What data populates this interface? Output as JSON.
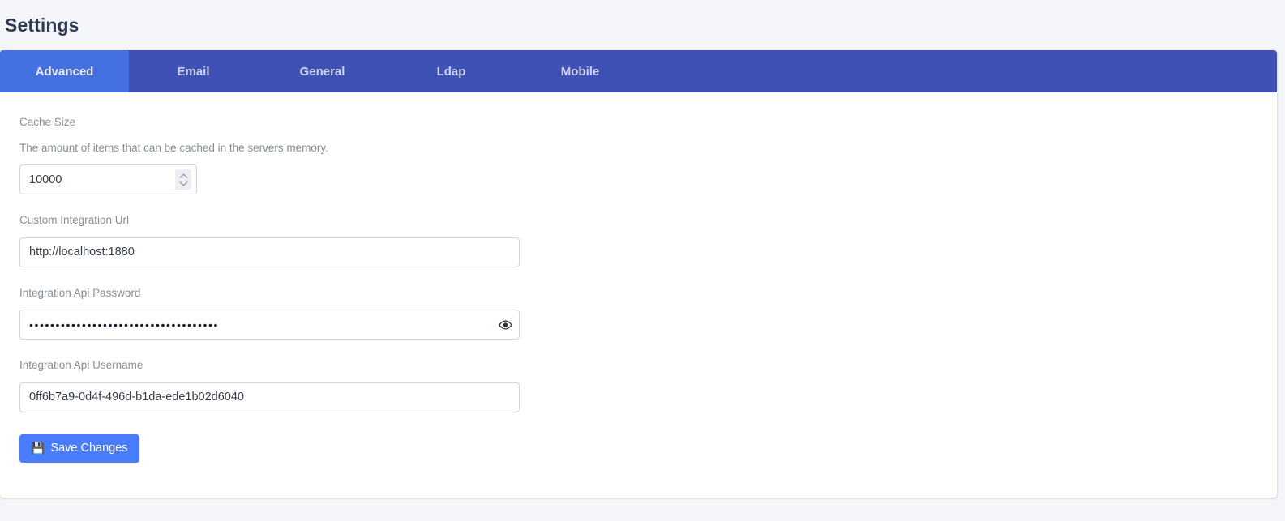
{
  "header": {
    "title": "Settings"
  },
  "tabs": {
    "active_index": 0,
    "items": [
      {
        "label": "Advanced"
      },
      {
        "label": "Email"
      },
      {
        "label": "General"
      },
      {
        "label": "Ldap"
      },
      {
        "label": "Mobile"
      }
    ]
  },
  "form": {
    "cache_size": {
      "label": "Cache Size",
      "help": "The amount of items that can be cached in the servers memory.",
      "value": "10000",
      "placeholder": "Cache Size"
    },
    "custom_integration_url": {
      "label": "Custom Integration Url",
      "value": "http://localhost:1880",
      "placeholder": "Custom Integration Url"
    },
    "integration_api_password": {
      "label": "Integration Api Password",
      "value": "••••••••••••••••••••••••••••••••••••",
      "placeholder": "Integration Api Password",
      "reveal_icon": "eye-icon"
    },
    "integration_api_username": {
      "label": "Integration Api Username",
      "value": "0ff6b7a9-0d4f-496d-b1da-ede1b02d6040",
      "placeholder": "Integration Api Username"
    },
    "save_button": {
      "label": "Save Changes",
      "icon": "floppy-disk-save-icon"
    }
  },
  "colors": {
    "page_background": "#f4f6f9",
    "tab_bar": "#3f51b5",
    "tab_active": "#4570e0",
    "primary_button": "#4a7dfc",
    "label_text": "#868e96",
    "title_text": "#2e3a52",
    "input_border": "#ced4da"
  }
}
